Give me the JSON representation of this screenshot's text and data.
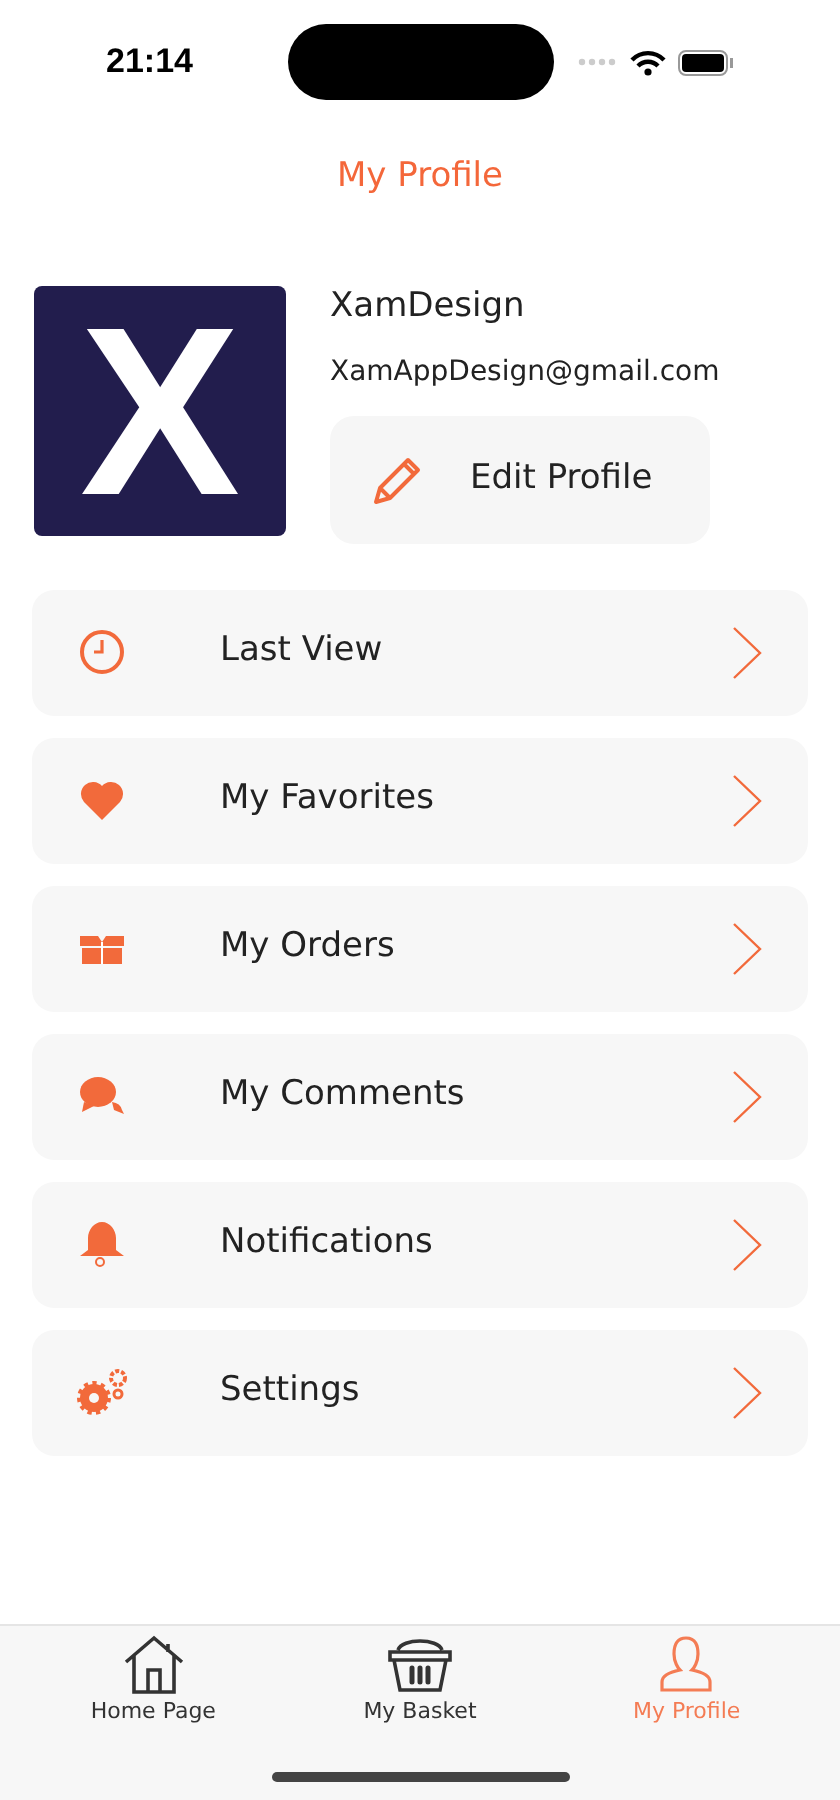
{
  "status_bar": {
    "time": "21:14"
  },
  "header": {
    "title": "My Profile"
  },
  "profile": {
    "logo_letter": "X",
    "name": "XamDesign",
    "email": "XamAppDesign@gmail.com",
    "edit_button": "Edit Profile"
  },
  "menu": [
    {
      "kind": "clock",
      "label": "Last View"
    },
    {
      "kind": "heart",
      "label": "My Favorites"
    },
    {
      "kind": "box",
      "label": "My Orders"
    },
    {
      "kind": "comments",
      "label": "My Comments"
    },
    {
      "kind": "bell",
      "label": "Notifications"
    },
    {
      "kind": "gears",
      "label": "Settings"
    }
  ],
  "tab_bar": [
    {
      "kind": "home",
      "label": "Home Page",
      "selected": false
    },
    {
      "kind": "basket",
      "label": "My Basket",
      "selected": false
    },
    {
      "kind": "person",
      "label": "My Profile",
      "selected": true
    }
  ]
}
